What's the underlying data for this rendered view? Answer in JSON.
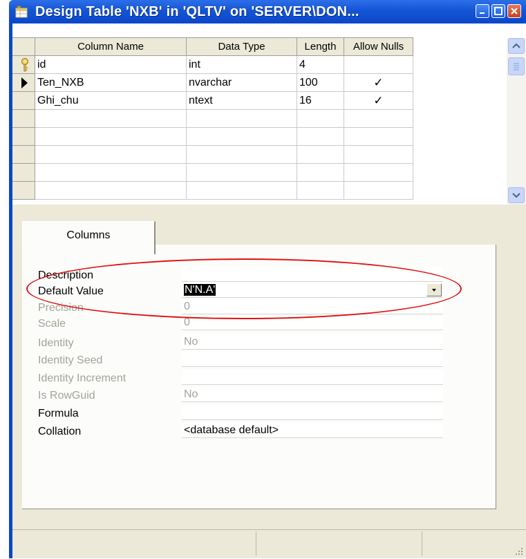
{
  "window": {
    "title": "Design Table 'NXB' in 'QLTV' on 'SERVER\\DON...",
    "icon": "table-design-icon"
  },
  "grid": {
    "columns": [
      "Column Name",
      "Data Type",
      "Length",
      "Allow Nulls"
    ],
    "rows": [
      {
        "indicator": "primary-key-icon",
        "name": "id",
        "type": "int",
        "length": "4",
        "allow_nulls": ""
      },
      {
        "indicator": "current-row-arrow-icon",
        "name": "Ten_NXB",
        "type": "nvarchar",
        "length": "100",
        "allow_nulls": "✓"
      },
      {
        "indicator": "",
        "name": "Ghi_chu",
        "type": "ntext",
        "length": "16",
        "allow_nulls": "✓"
      }
    ]
  },
  "tabs": {
    "columns_tab": "Columns"
  },
  "properties": [
    {
      "label": "Description",
      "value": "",
      "enabled": true
    },
    {
      "label": "Default Value",
      "value": "N'N.A'",
      "enabled": true
    },
    {
      "label": "Precision",
      "value": "0",
      "enabled": false
    },
    {
      "label": "Scale",
      "value": "0",
      "enabled": false
    },
    {
      "label": "Identity",
      "value": "No",
      "enabled": false
    },
    {
      "label": "Identity Seed",
      "value": "",
      "enabled": false
    },
    {
      "label": "Identity Increment",
      "value": "",
      "enabled": false
    },
    {
      "label": "Is RowGuid",
      "value": "No",
      "enabled": false
    },
    {
      "label": "Formula",
      "value": "",
      "enabled": true
    },
    {
      "label": "Collation",
      "value": "<database default>",
      "enabled": true
    }
  ],
  "colors": {
    "titlebar": "#0b47c8",
    "highlight_ellipse": "#e01010",
    "panel_bg": "#ece9d8"
  }
}
